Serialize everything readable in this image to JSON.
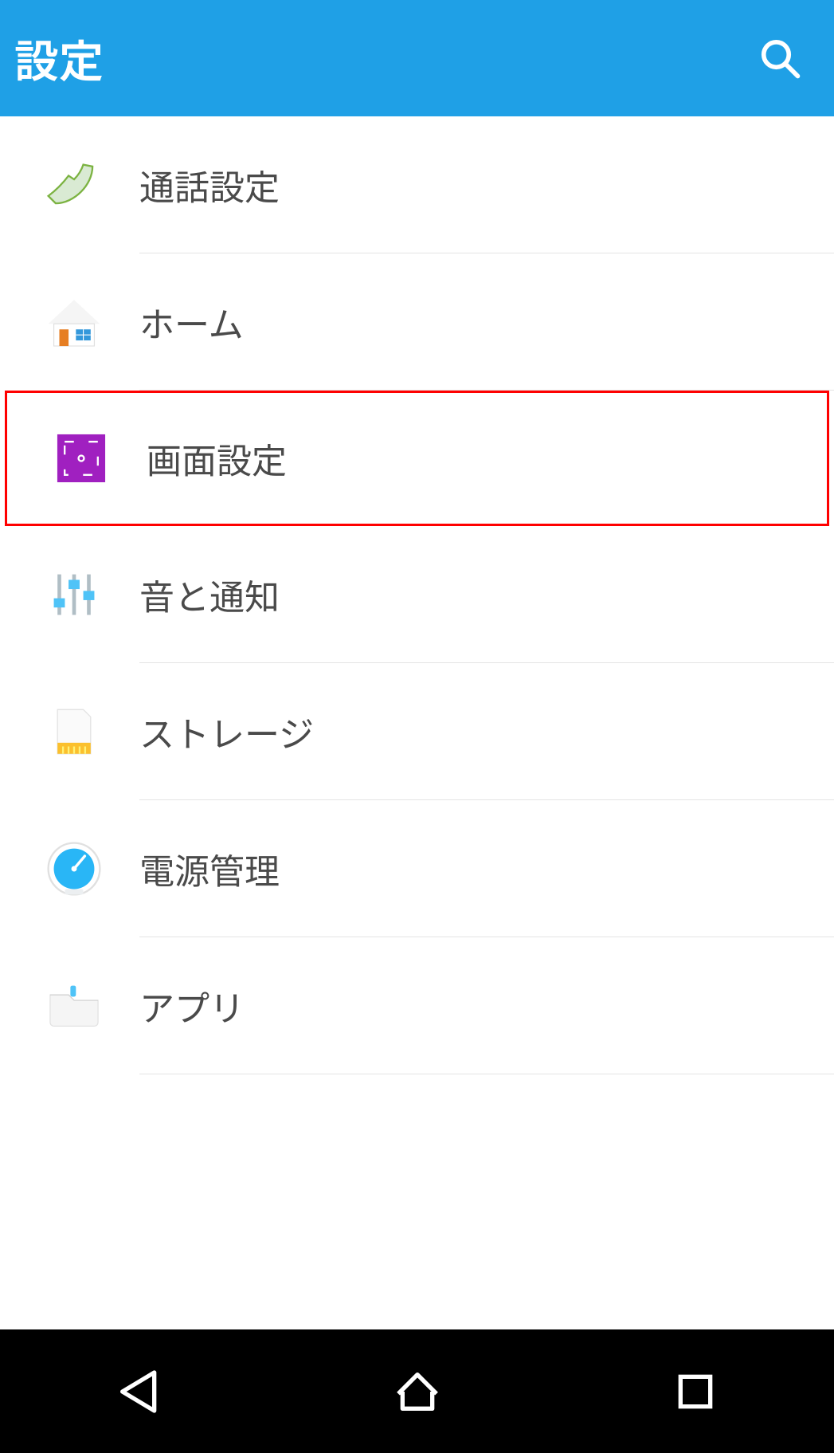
{
  "header": {
    "title": "設定",
    "search_icon": "search"
  },
  "settings_items": [
    {
      "id": "call",
      "label": "通話設定",
      "icon": "phone"
    },
    {
      "id": "home",
      "label": "ホーム",
      "icon": "house"
    },
    {
      "id": "display",
      "label": "画面設定",
      "icon": "display",
      "highlighted": true
    },
    {
      "id": "sound",
      "label": "音と通知",
      "icon": "sliders"
    },
    {
      "id": "storage",
      "label": "ストレージ",
      "icon": "sdcard"
    },
    {
      "id": "power",
      "label": "電源管理",
      "icon": "gauge"
    },
    {
      "id": "apps",
      "label": "アプリ",
      "icon": "folder"
    }
  ],
  "nav": {
    "back": "back",
    "home": "home",
    "recent": "recent"
  },
  "colors": {
    "accent": "#1fa0e6",
    "highlight_border": "#ff0000"
  }
}
